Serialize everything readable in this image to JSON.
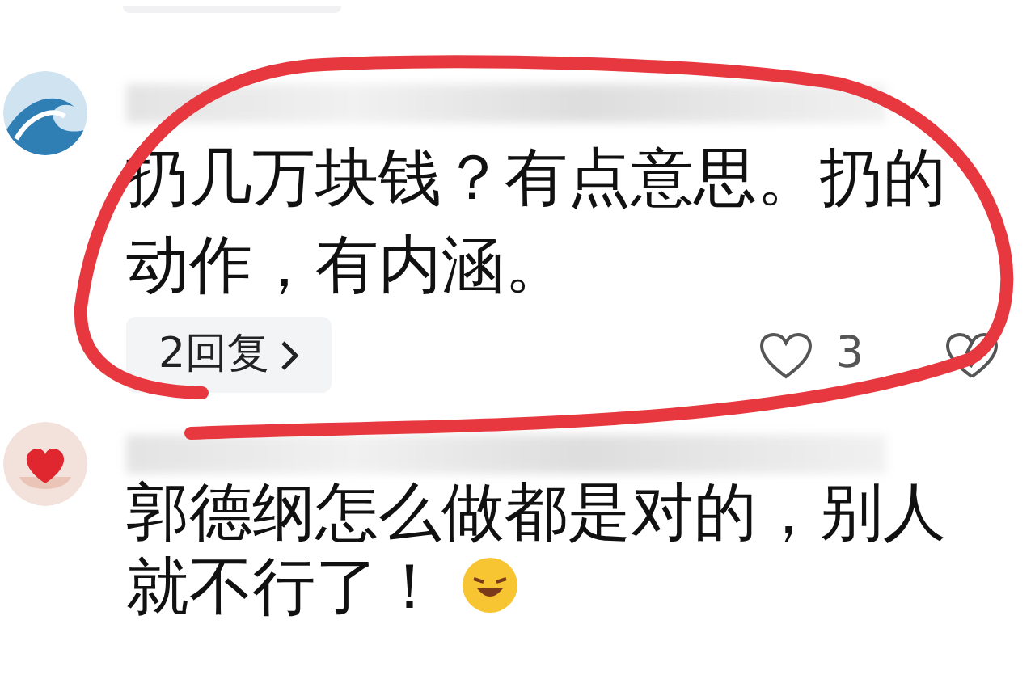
{
  "comments": [
    {
      "kind": "wave",
      "text": "扔几万块钱？有点意思。扔的动作，有内涵。",
      "replies": "2回复",
      "likes": "3"
    },
    {
      "kind": "heart",
      "text": "郭德纲怎么做都是对的，别人就不行了！"
    }
  ]
}
